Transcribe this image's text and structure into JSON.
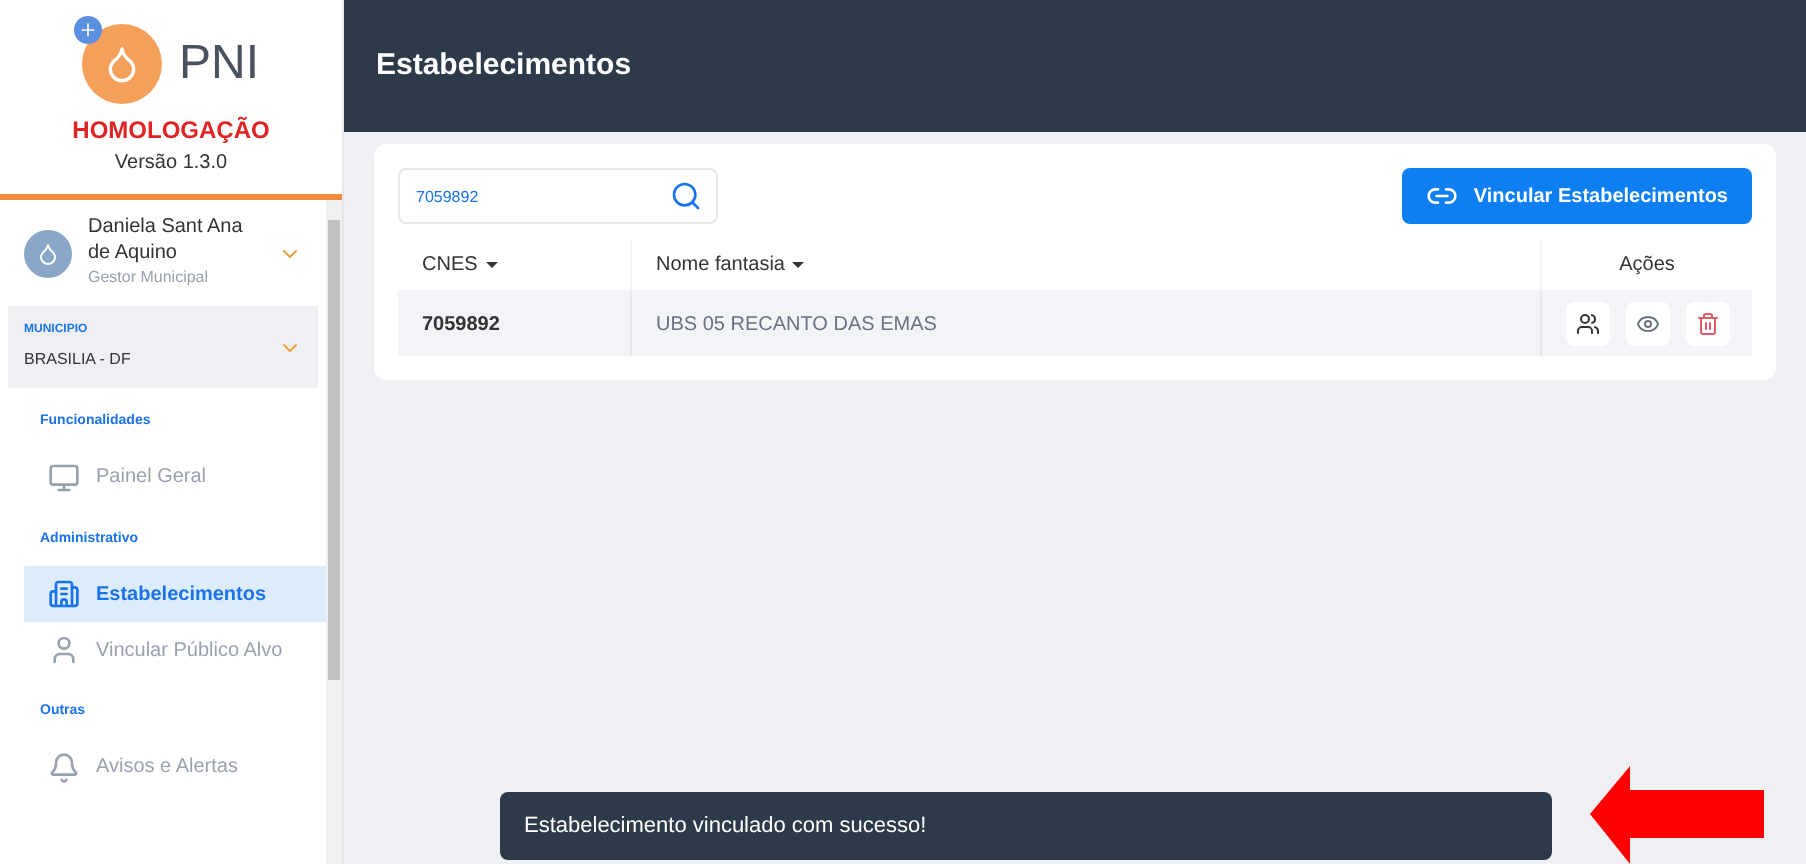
{
  "brand": {
    "name": "PNI",
    "environment": "HOMOLOGAÇÃO",
    "version": "Versão 1.3.0"
  },
  "user": {
    "name": "Daniela Sant Ana de Aquino",
    "role": "Gestor Municipal"
  },
  "municipality": {
    "label": "MUNICIPIO",
    "value": "BRASILIA - DF"
  },
  "menu": [
    {
      "kind": "section",
      "label": "Funcionalidades"
    },
    {
      "kind": "item",
      "label": "Painel Geral",
      "selected": false
    },
    {
      "kind": "section",
      "label": "Administrativo"
    },
    {
      "kind": "item",
      "label": "Estabelecimentos",
      "selected": true
    },
    {
      "kind": "item",
      "label": "Vincular Público Alvo",
      "selected": false
    },
    {
      "kind": "section",
      "label": "Outras"
    },
    {
      "kind": "item",
      "label": "Avisos e Alertas",
      "selected": false
    }
  ],
  "header": {
    "title": "Estabelecimentos"
  },
  "search": {
    "value": "7059892"
  },
  "link_button": "Vincular Estabelecimentos",
  "table": {
    "columns": [
      {
        "label": "CNES",
        "sortable": true
      },
      {
        "label": "Nome fantasia",
        "sortable": true
      },
      {
        "label": "Ações",
        "sortable": false
      }
    ],
    "rows": [
      {
        "cnes": "7059892",
        "name": "UBS 05 RECANTO DAS EMAS"
      }
    ]
  },
  "toast": "Estabelecimento vinculado com sucesso!"
}
